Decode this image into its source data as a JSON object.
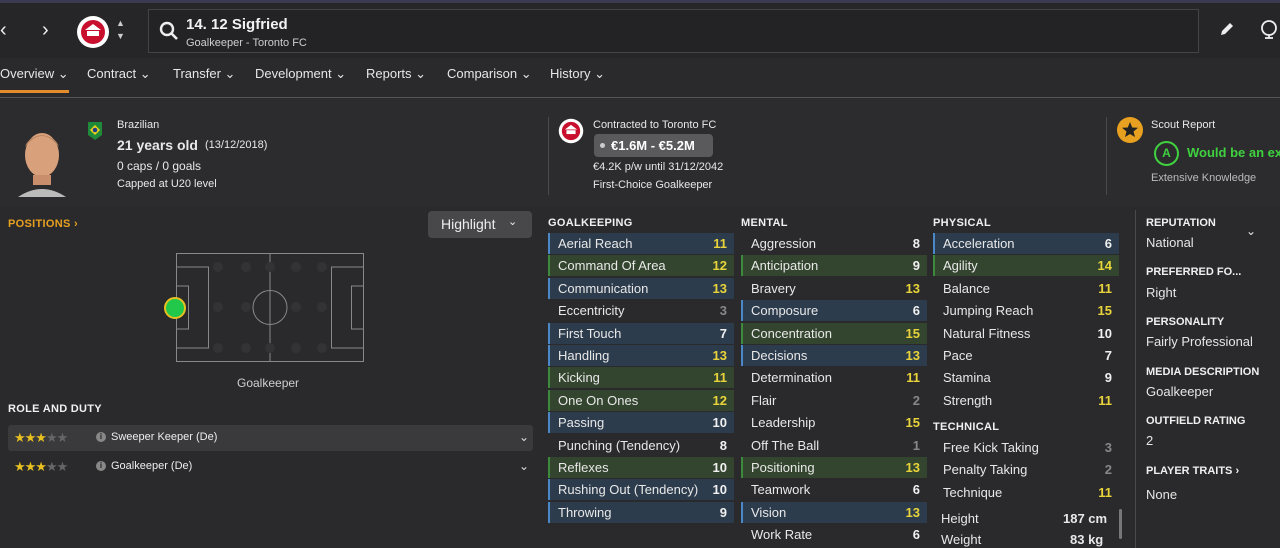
{
  "topbar": {
    "back_arrow": "‹",
    "forward_arrow": "›",
    "player_name": "14. 12 Sigfried",
    "player_sub": "Goalkeeper - Toronto FC"
  },
  "tabs": [
    "Overview",
    "Contract",
    "Transfer",
    "Development",
    "Reports",
    "Comparison",
    "History"
  ],
  "profile": {
    "nationality": "Brazilian",
    "age": "21 years old",
    "dob": "(13/12/2018)",
    "caps": "0 caps / 0 goals",
    "capped": "Capped at U20 level"
  },
  "contract": {
    "label": "Contracted to Toronto FC",
    "value": "€1.6M - €5.2M",
    "wage": "€4.2K p/w until 31/12/2042",
    "status": "First-Choice Goalkeeper"
  },
  "scout": {
    "title": "Scout Report",
    "grade": "A",
    "verdict": "Would be an exc",
    "knowledge": "Extensive Knowledge"
  },
  "positions": {
    "title": "POSITIONS",
    "highlight": "Highlight",
    "position_label": "Goalkeeper"
  },
  "roles": {
    "title": "ROLE AND DUTY",
    "items": [
      {
        "stars": 3,
        "label": "Sweeper Keeper (De)"
      },
      {
        "stars": 3,
        "label": "Goalkeeper (De)"
      }
    ]
  },
  "attributes": {
    "goalkeeping": {
      "title": "GOALKEEPING",
      "rows": [
        {
          "name": "Aerial Reach",
          "value": "11",
          "hl": "blue"
        },
        {
          "name": "Command Of Area",
          "value": "12",
          "hl": "green"
        },
        {
          "name": "Communication",
          "value": "13",
          "hl": "blue"
        },
        {
          "name": "Eccentricity",
          "value": "3",
          "hl": "plain"
        },
        {
          "name": "First Touch",
          "value": "7",
          "hl": "blue"
        },
        {
          "name": "Handling",
          "value": "13",
          "hl": "blue"
        },
        {
          "name": "Kicking",
          "value": "11",
          "hl": "green"
        },
        {
          "name": "One On Ones",
          "value": "12",
          "hl": "green"
        },
        {
          "name": "Passing",
          "value": "10",
          "hl": "blue"
        },
        {
          "name": "Punching (Tendency)",
          "value": "8",
          "hl": "plain"
        },
        {
          "name": "Reflexes",
          "value": "10",
          "hl": "green"
        },
        {
          "name": "Rushing Out (Tendency)",
          "value": "10",
          "hl": "blue"
        },
        {
          "name": "Throwing",
          "value": "9",
          "hl": "blue"
        }
      ]
    },
    "mental": {
      "title": "MENTAL",
      "rows": [
        {
          "name": "Aggression",
          "value": "8",
          "hl": "plain"
        },
        {
          "name": "Anticipation",
          "value": "9",
          "hl": "green"
        },
        {
          "name": "Bravery",
          "value": "13",
          "hl": "plain"
        },
        {
          "name": "Composure",
          "value": "6",
          "hl": "blue"
        },
        {
          "name": "Concentration",
          "value": "15",
          "hl": "green"
        },
        {
          "name": "Decisions",
          "value": "13",
          "hl": "blue"
        },
        {
          "name": "Determination",
          "value": "11",
          "hl": "plain"
        },
        {
          "name": "Flair",
          "value": "2",
          "hl": "plain"
        },
        {
          "name": "Leadership",
          "value": "15",
          "hl": "plain"
        },
        {
          "name": "Off The Ball",
          "value": "1",
          "hl": "plain"
        },
        {
          "name": "Positioning",
          "value": "13",
          "hl": "green"
        },
        {
          "name": "Teamwork",
          "value": "6",
          "hl": "plain"
        },
        {
          "name": "Vision",
          "value": "13",
          "hl": "blue"
        },
        {
          "name": "Work Rate",
          "value": "6",
          "hl": "plain"
        }
      ]
    },
    "physical": {
      "title": "PHYSICAL",
      "rows": [
        {
          "name": "Acceleration",
          "value": "6",
          "hl": "blue"
        },
        {
          "name": "Agility",
          "value": "14",
          "hl": "green"
        },
        {
          "name": "Balance",
          "value": "11",
          "hl": "plain"
        },
        {
          "name": "Jumping Reach",
          "value": "15",
          "hl": "plain"
        },
        {
          "name": "Natural Fitness",
          "value": "10",
          "hl": "plain"
        },
        {
          "name": "Pace",
          "value": "7",
          "hl": "plain"
        },
        {
          "name": "Stamina",
          "value": "9",
          "hl": "plain"
        },
        {
          "name": "Strength",
          "value": "11",
          "hl": "plain"
        }
      ]
    },
    "technical": {
      "title": "TECHNICAL",
      "rows": [
        {
          "name": "Free Kick Taking",
          "value": "3",
          "hl": "plain"
        },
        {
          "name": "Penalty Taking",
          "value": "2",
          "hl": "plain"
        },
        {
          "name": "Technique",
          "value": "11",
          "hl": "plain"
        }
      ]
    },
    "height_label": "Height",
    "height_value": "187 cm",
    "weight_label": "Weight",
    "weight_value": "83 kg"
  },
  "sidebar": [
    {
      "title": "REPUTATION",
      "value": "National"
    },
    {
      "title": "PREFERRED FO...",
      "value": "Right"
    },
    {
      "title": "PERSONALITY",
      "value": "Fairly Professional"
    },
    {
      "title": "MEDIA DESCRIPTION",
      "value": "Goalkeeper"
    },
    {
      "title": "OUTFIELD RATING",
      "value": "2"
    },
    {
      "title": "PLAYER TRAITS",
      "value": "None"
    }
  ],
  "colors": {
    "accent": "#e28c2c",
    "high_value": "#e8d43a",
    "low_value": "#888888",
    "grade_green": "#3fd13f",
    "key_attr_blue": "#2d3c4d",
    "key_attr_green": "#34452f"
  }
}
